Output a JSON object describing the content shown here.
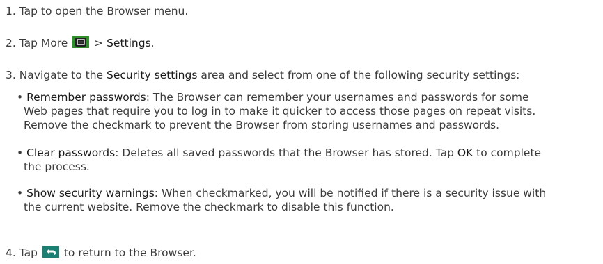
{
  "steps": {
    "s1": "1. Tap to open the Browser menu.",
    "s2_prefix": "2. Tap More",
    "s2_sep": " > ",
    "s2_settings": "Settings",
    "s2_end": ".",
    "s3_prefix": "3. Navigate to the ",
    "s3_area": "Security settings",
    "s3_suffix": " area and select from one of the following security settings:",
    "s4_prefix": "4. Tap",
    "s4_suffix": "to return to the Browser."
  },
  "bullets": {
    "remember": {
      "marker": "• ",
      "title": "Remember passwords",
      "line1": ": The Browser can remember your usernames and passwords for some",
      "line2": "Web pages that require you to log in to make it quicker to access those pages on repeat visits.",
      "line3": "Remove the checkmark to prevent the Browser from storing usernames and passwords."
    },
    "clear": {
      "marker": "• ",
      "title": "Clear passwords",
      "line1a": ": Deletes all saved passwords that the Browser has stored. Tap ",
      "ok": "OK",
      "line1b": " to complete",
      "line2": "the process."
    },
    "warnings": {
      "marker": "• ",
      "title": "Show security warnings",
      "line1": ": When checkmarked, you will be notified if there is a security issue with",
      "line2": "the current website. Remove the checkmark to disable this function."
    }
  },
  "icons": {
    "more_icon": "menu-icon",
    "back_icon": "back-arrow-icon",
    "icon_green": "#2f8f2a",
    "icon_teal": "#1c7f73"
  }
}
